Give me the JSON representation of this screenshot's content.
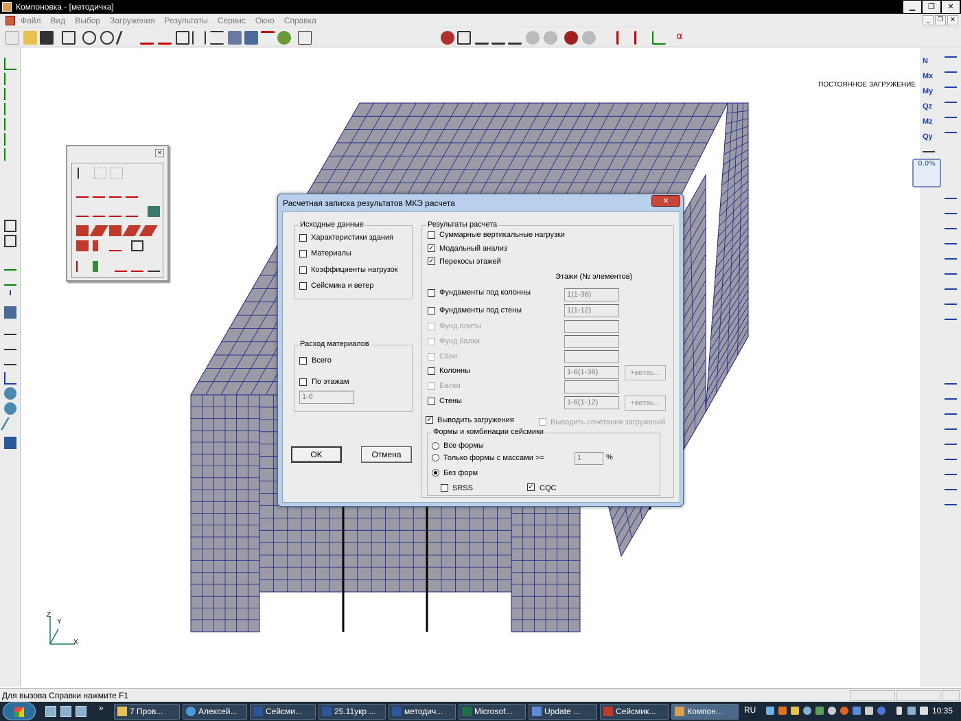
{
  "window": {
    "title": "Компоновка - [методичка]",
    "min_label": "▁",
    "max_label": "❐",
    "close_label": "✕"
  },
  "menu": {
    "items": [
      "Файл",
      "Вид",
      "Выбор",
      "Загружения",
      "Результаты",
      "Сервис",
      "Окно",
      "Справка"
    ]
  },
  "mdi_buttons": [
    "_",
    "❐",
    "✕"
  ],
  "canvas": {
    "load_case_label": "ПОСТОЯННОЕ ЗАГРУЖЕНИЕ",
    "axes": {
      "z": "Z",
      "y": "Y",
      "x": "X"
    },
    "mesh_fill": "#9b9ba6",
    "mesh_line": "#1f1f8c"
  },
  "right_panel": {
    "force_buttons": [
      "N",
      "Mx",
      "My",
      "Qz",
      "Mz",
      "Qy"
    ],
    "progress_value": "0.0%"
  },
  "dialog": {
    "title": "Расчетная записка результатов МКЭ расчета",
    "close_label": "✕",
    "source_group": {
      "legend": "Исходные данные",
      "items": [
        {
          "label": "Характеристики здания",
          "checked": false
        },
        {
          "label": "Материалы",
          "checked": false
        },
        {
          "label": "Коэффициенты нагрузок",
          "checked": false
        },
        {
          "label": "Сейсмика и ветер",
          "checked": false
        }
      ]
    },
    "materials_group": {
      "legend": "Расход материалов",
      "total_label": "Всего",
      "by_floor_label": "По этажам",
      "floors_value": "1-6"
    },
    "results_group": {
      "legend": "Результаты расчета",
      "top_items": [
        {
          "label": "Суммарные вертикальные нагрузки",
          "checked": false
        },
        {
          "label": "Модальный анализ",
          "checked": true
        },
        {
          "label": "Перекосы этажей",
          "checked": true
        }
      ],
      "floors_header": "Этажи (№ элементов)",
      "rows": [
        {
          "label": "Фундаменты под колонны",
          "value": "1(1-36)",
          "enabled": true,
          "branch": ""
        },
        {
          "label": "Фундаменты под стены",
          "value": "1(1-12)",
          "enabled": true,
          "branch": ""
        },
        {
          "label": "Фунд.плиты",
          "value": "",
          "enabled": false,
          "branch": ""
        },
        {
          "label": "Фунд.балки",
          "value": "",
          "enabled": false,
          "branch": ""
        },
        {
          "label": "Сваи",
          "value": "",
          "enabled": false,
          "branch": ""
        },
        {
          "label": "Колонны",
          "value": "1-6(1-36)",
          "enabled": true,
          "branch": "+ветвь..."
        },
        {
          "label": "Балки",
          "value": "",
          "enabled": false,
          "branch": ""
        },
        {
          "label": "Стены",
          "value": "1-6(1-12)",
          "enabled": true,
          "branch": "+ветвь..."
        }
      ],
      "output_loads_label": "Выводить загружения",
      "output_loads_checked": true,
      "output_combos_label": "Выводить сочетания загружений",
      "seismic_group": {
        "legend": "Формы и комбинации сейсмики",
        "all_forms_label": "Все формы",
        "mass_forms_label": "Только формы с массами >=",
        "mass_value": "1",
        "mass_unit": "%",
        "no_forms_label": "Без форм",
        "selected": "no_forms",
        "srss_label": "SRSS",
        "srss_checked": false,
        "cqc_label": "CQC",
        "cqc_checked": true
      }
    },
    "ok_label": "OK",
    "cancel_label": "Отмена"
  },
  "status": {
    "text": "Для вызова Справки нажмите F1"
  },
  "taskbar": {
    "tasks": [
      "7 Пров...",
      "Алексей...",
      "Сейсми...",
      "25.11укр ...",
      "методич...",
      "Microsof...",
      "Update ...",
      "Сейсмик...",
      "Компон..."
    ],
    "language": "RU",
    "clock": "10:35",
    "overflow": "»"
  }
}
